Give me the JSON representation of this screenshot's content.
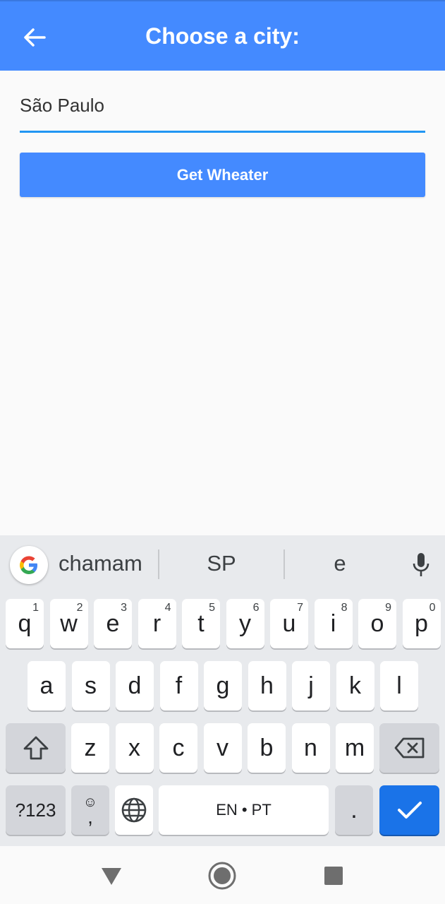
{
  "appbar": {
    "title": "Choose a city:",
    "back_icon": "arrow-left-icon"
  },
  "form": {
    "city_value": "São Paulo",
    "button_label": "Get Wheater"
  },
  "keyboard": {
    "suggestions": [
      "chamam",
      "SP",
      "e"
    ],
    "row1": [
      {
        "key": "q",
        "hint": "1"
      },
      {
        "key": "w",
        "hint": "2"
      },
      {
        "key": "e",
        "hint": "3"
      },
      {
        "key": "r",
        "hint": "4"
      },
      {
        "key": "t",
        "hint": "5"
      },
      {
        "key": "y",
        "hint": "6"
      },
      {
        "key": "u",
        "hint": "7"
      },
      {
        "key": "i",
        "hint": "8"
      },
      {
        "key": "o",
        "hint": "9"
      },
      {
        "key": "p",
        "hint": "0"
      }
    ],
    "row2": [
      "a",
      "s",
      "d",
      "f",
      "g",
      "h",
      "j",
      "k",
      "l"
    ],
    "row3": [
      "z",
      "x",
      "c",
      "v",
      "b",
      "n",
      "m"
    ],
    "symbols_label": "?123",
    "comma_label": ",",
    "space_label": "EN • PT",
    "period_label": ".",
    "colors": {
      "accent": "#448aff",
      "enter": "#1a73e8",
      "underline": "#2196f3"
    }
  }
}
